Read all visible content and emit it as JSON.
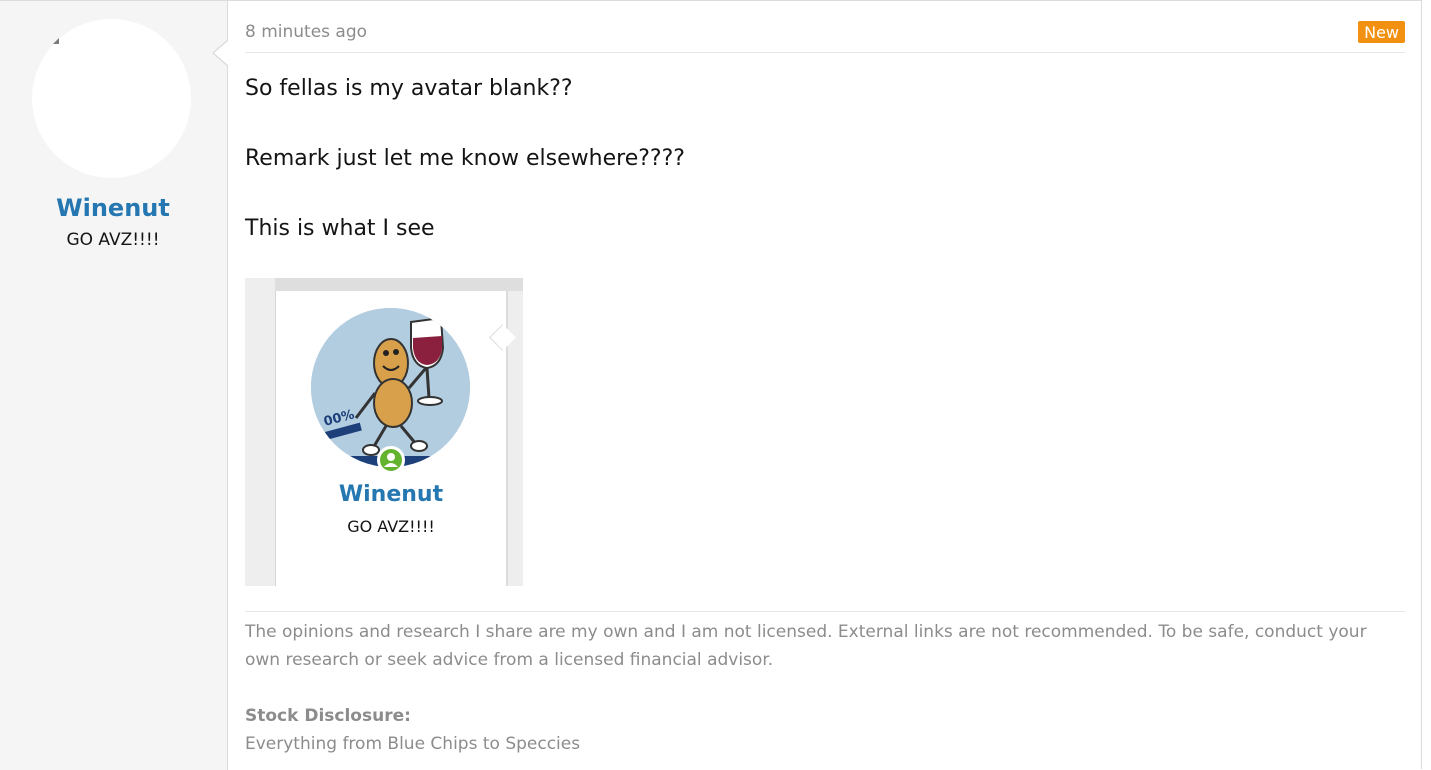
{
  "user": {
    "name": "Winenut",
    "title": "GO AVZ!!!!"
  },
  "post": {
    "time": "8 minutes ago",
    "badge": "New",
    "lines": [
      "So fellas is my avatar blank??",
      "Remark just let me know elsewhere????",
      "This is what I see"
    ]
  },
  "screenshot": {
    "name": "Winenut",
    "title": "GO AVZ!!!!",
    "avatar_text": "00%"
  },
  "signature": {
    "disclaimer": "The opinions and research I share are my own and I am not licensed. External links are not recommended. To be safe, conduct your own research or seek advice from a licensed financial advisor.",
    "label": "Stock Disclosure:",
    "value": "Everything from Blue Chips to Speccies"
  },
  "colors": {
    "username": "#2577b1",
    "badge": "#f29111",
    "online": "#63b32e"
  }
}
